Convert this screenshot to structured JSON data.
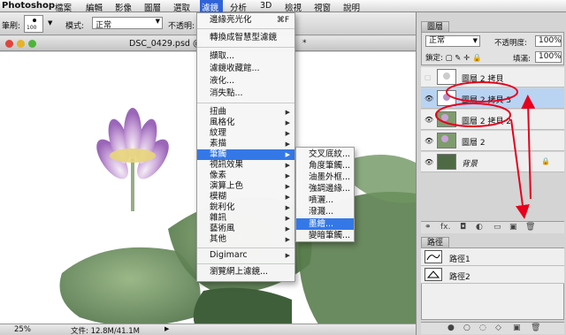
{
  "menubar": {
    "app": "Photoshop",
    "items": [
      "檔案",
      "編輯",
      "影像",
      "圖層",
      "選取",
      "濾鏡",
      "分析",
      "3D",
      "檢視",
      "視窗",
      "說明"
    ]
  },
  "options": {
    "brush_label": "筆刷:",
    "brush_size": "100",
    "mode_label": "模式:",
    "mode_value": "正常",
    "opacity_label": "不透明:"
  },
  "document": {
    "title": "DSC_0429.psd @",
    "title_suffix": "*",
    "zoom": "25%",
    "file_info": "文件: 12.8M/41.1M"
  },
  "filter_menu": {
    "items": [
      {
        "label": "邊緣亮光化",
        "shortcut": "⌘F"
      },
      {
        "label": "轉換成智慧型濾鏡"
      },
      {
        "label": "擷取..."
      },
      {
        "label": "濾鏡收藏館..."
      },
      {
        "label": "液化..."
      },
      {
        "label": "消失點..."
      },
      {
        "label": "扭曲",
        "sub": true
      },
      {
        "label": "風格化",
        "sub": true
      },
      {
        "label": "紋理",
        "sub": true
      },
      {
        "label": "素描",
        "sub": true
      },
      {
        "label": "筆觸",
        "sub": true
      },
      {
        "label": "視訊效果",
        "sub": true
      },
      {
        "label": "像素",
        "sub": true
      },
      {
        "label": "演算上色",
        "sub": true
      },
      {
        "label": "模糊",
        "sub": true
      },
      {
        "label": "銳利化",
        "sub": true
      },
      {
        "label": "雜訊",
        "sub": true
      },
      {
        "label": "藝術風",
        "sub": true
      },
      {
        "label": "其他",
        "sub": true
      },
      {
        "label": "Digimarc",
        "sub": true
      },
      {
        "label": "瀏覽網上濾鏡..."
      }
    ]
  },
  "stroke_submenu": {
    "items": [
      "交叉底紋...",
      "角度筆觸...",
      "油墨外框...",
      "強調邊緣...",
      "噴灑...",
      "潑濺...",
      "墨繪...",
      "變暗筆觸..."
    ]
  },
  "layers_panel": {
    "tab": "圖層",
    "blend_mode": "正常",
    "opacity_label": "不透明度:",
    "opacity_value": "100%",
    "fill_label": "填滿:",
    "fill_value": "100%",
    "layers": [
      {
        "name": "圖層 2 拷貝",
        "visible": false
      },
      {
        "name": "圖層 2 拷貝 3",
        "visible": true,
        "selected": true
      },
      {
        "name": "圖層 2 拷貝 2",
        "visible": true
      },
      {
        "name": "圖層 2",
        "visible": true
      },
      {
        "name": "背景",
        "visible": true,
        "italic": true
      }
    ]
  },
  "paths_panel": {
    "tab": "路徑",
    "paths": [
      "路徑1",
      "路徑2"
    ]
  },
  "colors": {
    "highlight": "#3478e8",
    "annotation": "#e8001c",
    "selected_layer": "#b9d3f3"
  }
}
